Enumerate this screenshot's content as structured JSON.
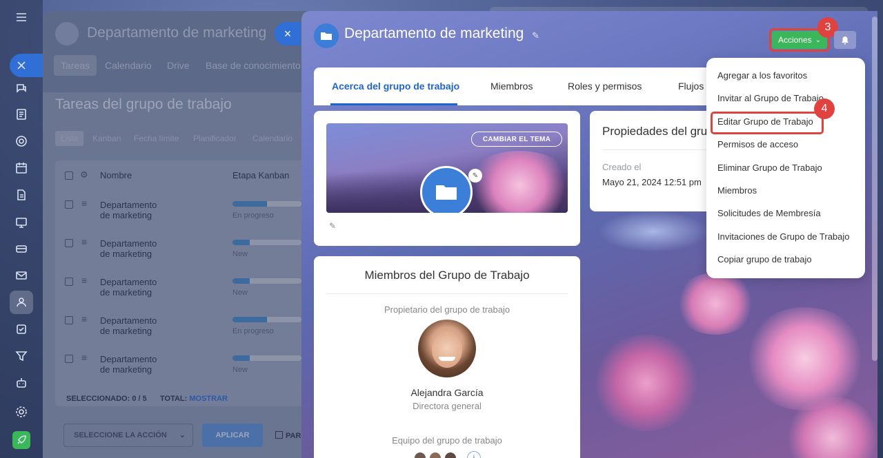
{
  "app": {
    "accent": "#2f6fd6",
    "highlight": "#e0433f",
    "action_color": "#3cb65a"
  },
  "sidebar": {
    "icons": [
      "menu-icon",
      "close-icon",
      "chat-icon",
      "feed-icon",
      "target-icon",
      "calendar-icon",
      "document-icon",
      "board-icon",
      "storage-icon",
      "mail-icon",
      "groups-icon",
      "tasks-icon",
      "funnel-icon",
      "robot-icon",
      "settings-icon",
      "rocket-icon"
    ]
  },
  "back_panel": {
    "title": "Departamento de marketing",
    "tabs": [
      "Tareas",
      "Calendario",
      "Drive",
      "Base de conocimiento"
    ],
    "subtitle": "Tareas del grupo de trabajo",
    "view_tabs": [
      "Lista",
      "Kanban",
      "Fecha límite",
      "Planificador",
      "Calendario"
    ],
    "columns": {
      "name": "Nombre",
      "stage": "Etapa Kanban"
    },
    "rows": [
      {
        "name1": "Departamento",
        "name2": "de marketing",
        "stage": "En progreso",
        "progress": 0.5
      },
      {
        "name1": "Departamento",
        "name2": "de marketing",
        "stage": "New",
        "progress": 0.25
      },
      {
        "name1": "Departamento",
        "name2": "de marketing",
        "stage": "New",
        "progress": 0.25
      },
      {
        "name1": "Departamento",
        "name2": "de marketing",
        "stage": "En progreso",
        "progress": 0.5
      },
      {
        "name1": "Departamento",
        "name2": "de marketing",
        "stage": "New",
        "progress": 0.25
      }
    ],
    "selected_label": "SELECCIONADO:",
    "selected_value": "0 / 5",
    "total_label": "TOTAL:",
    "total_link": "MOSTRAR",
    "action_select": "SELECCIONE LA ACCIÓN",
    "apply_button": "APLICAR",
    "partial_checkbox": "PAR"
  },
  "main": {
    "close_label": "×",
    "title": "Departamento de marketing",
    "actions_button": "Acciones",
    "tabs": [
      "Acerca del grupo de trabajo",
      "Miembros",
      "Roles y permisos",
      "Flujos"
    ],
    "active_tab": "Acerca del grupo de trabajo",
    "cover_button": "CAMBIAR EL TEMA",
    "properties_title": "Propiedades del gru",
    "created_label": "Creado el",
    "created_value": "Mayo 21, 2024 12:51 pm",
    "members_title": "Miembros del Grupo de Trabajo",
    "owner_label": "Propietario del grupo de trabajo",
    "owner_name": "Alejandra García",
    "owner_role": "Directora general",
    "team_label": "Equipo del grupo de trabajo"
  },
  "menu": {
    "items": [
      "Agregar a los favoritos",
      "Invitar al Grupo de Trabajo",
      "Editar Grupo de Trabajo",
      "Permisos de acceso",
      "Eliminar Grupo de Trabajo",
      "Miembros",
      "Solicitudes de Membresía",
      "Invitaciones de Grupo de Trabajo",
      "Copiar grupo de trabajo"
    ],
    "highlighted": "Editar Grupo de Trabajo"
  },
  "badges": {
    "actions_step": "3",
    "edit_step": "4"
  }
}
